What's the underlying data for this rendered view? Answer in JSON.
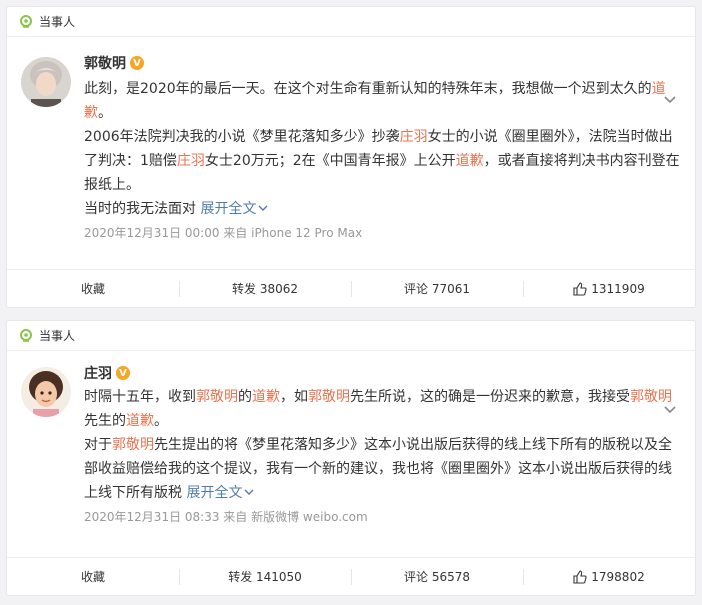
{
  "post1": {
    "tag": "当事人",
    "author": "郭敬明",
    "verified_badge": "V",
    "para1": {
      "a": "此刻，是2020年的最后一天。在这个对生命有重新认知的特殊年末，我想做一个迟到太久的",
      "b": "道歉",
      "c": "。"
    },
    "para2": {
      "a": "2006年法院判决我的小说《梦里花落知多少》抄袭",
      "b": "庄羽",
      "c": "女士的小说《圈里圈外》，法院当时做出了判决：1赔偿",
      "d": "庄羽",
      "e": "女士20万元；2在《中国青年报》上公开",
      "f": "道歉",
      "g": "，或者直接将判决书内容刊登在报纸上。"
    },
    "para3": "当时的我无法面对",
    "expand": "展开全文",
    "meta": "2020年12月31日 00:00  来自 iPhone 12 Pro Max",
    "actions": {
      "collect": "收藏",
      "repost": "转发 38062",
      "comment": "评论 77061",
      "like": "1311909"
    }
  },
  "post2": {
    "tag": "当事人",
    "author": "庄羽",
    "verified_badge": "V",
    "para1": {
      "a": "时隔十五年，收到",
      "b": "郭敬明",
      "c": "的",
      "d": "道歉",
      "e": "，如",
      "f": "郭敬明",
      "g": "先生所说，这的确是一份迟来的歉意，我接受",
      "h": "郭敬明",
      "i": "先生的",
      "j": "道歉",
      "k": "。"
    },
    "para2": {
      "a": "对于",
      "b": "郭敬明",
      "c": "先生提出的将《梦里花落知多少》这本小说出版后获得的线上线下所有的版税以及全部收益赔偿给我的这个提议，我有一个新的建议，我也将《圈里圈外》这本小说出版后获得的线上线下所有版税"
    },
    "expand": "展开全文",
    "meta": "2020年12月31日 08:33  来自 新版微博 weibo.com",
    "actions": {
      "collect": "收藏",
      "repost": "转发 141050",
      "comment": "评论 56578",
      "like": "1798802"
    }
  },
  "colors": {
    "highlight": "#eb7350",
    "link": "#507daf",
    "badge": "#f5a623",
    "tag_icon": "#8bc34a"
  }
}
